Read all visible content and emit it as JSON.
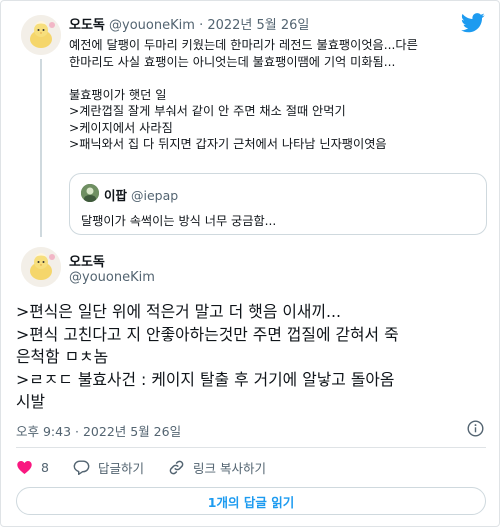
{
  "parent_tweet": {
    "author_name": "오도독",
    "author_handle": "@youoneKim",
    "separator": "·",
    "date": "2022년 5월 26일",
    "lines": [
      "예전에 달팽이 두마리 키웠는데 한마리가 레전드 불효팽이엇음...다른",
      "한마리도 사실 효팽이는 아니엇는데 불효팽이땜에 기억 미화됨...",
      "",
      "불효팽이가 햇던 일",
      ">계란껍질 잘게 부숴서 같이 안 주면 채소 절때 안먹기",
      ">케이지에서 사라짐",
      ">패닉와서 집 다 뒤지면 갑자기 근처에서 나타남 닌자팽이엿음"
    ],
    "quote": {
      "author_name": "이팝",
      "author_handle": "@iepap",
      "text": "달팽이가 속썩이는 방식 너무 궁금함..."
    }
  },
  "main_tweet": {
    "author_name": "오도독",
    "author_handle": "@youoneKim",
    "lines": [
      ">편식은 일단 위에 적은거 말고 더 햇음 이새끼...",
      ">편식 고친다고 지 안좋아하는것만 주면 껍질에 갇혀서 죽",
      "은척함 ㅁㅊ놈",
      ">ㄹㅈㄷ 불효사건 : 케이지 탈출 후 거기에 알낳고 돌아옴",
      "시발"
    ],
    "timestamp": "오후 9:43 · 2022년 5월 26일",
    "actions": {
      "like_count": "8",
      "reply_label": "답글하기",
      "copy_link_label": "링크 복사하기"
    },
    "read_replies_label": "1개의 답글 읽기"
  },
  "colors": {
    "accent": "#1d9bf0",
    "like": "#f91880",
    "text": "#0f1419",
    "secondary": "#536471",
    "border": "#cfd9de"
  },
  "icons": [
    "twitter-logo-icon",
    "info-icon",
    "heart-icon",
    "reply-bubble-icon",
    "link-icon"
  ]
}
